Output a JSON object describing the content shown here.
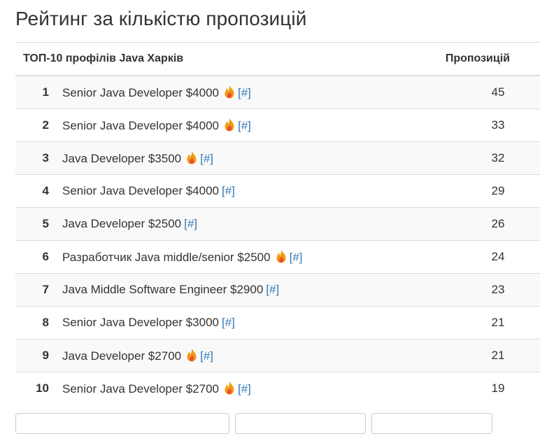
{
  "page": {
    "title": "Рейтинг за кількістю пропозицій"
  },
  "table": {
    "header_title": "ТОП-10 профілів Java Харків",
    "header_count": "Пропозицій",
    "link_label": "[#]",
    "rows": [
      {
        "rank": "1",
        "title": "Senior Java Developer $4000",
        "hot": true,
        "count": "45"
      },
      {
        "rank": "2",
        "title": "Senior Java Developer $4000",
        "hot": true,
        "count": "33"
      },
      {
        "rank": "3",
        "title": "Java Developer $3500",
        "hot": true,
        "count": "32"
      },
      {
        "rank": "4",
        "title": "Senior Java Developer $4000",
        "hot": false,
        "count": "29"
      },
      {
        "rank": "5",
        "title": "Java Developer $2500",
        "hot": false,
        "count": "26"
      },
      {
        "rank": "6",
        "title": "Разработчик Java middle/senior $2500",
        "hot": true,
        "count": "24"
      },
      {
        "rank": "7",
        "title": "Java Middle Software Engineer $2900",
        "hot": false,
        "count": "23"
      },
      {
        "rank": "8",
        "title": "Senior Java Developer $3000",
        "hot": false,
        "count": "21"
      },
      {
        "rank": "9",
        "title": "Java Developer $2700",
        "hot": true,
        "count": "21"
      },
      {
        "rank": "10",
        "title": "Senior Java Developer $2700",
        "hot": true,
        "count": "19"
      }
    ]
  },
  "icons": {
    "hot": "fire-icon"
  },
  "colors": {
    "link": "#337ab7",
    "text": "#333333",
    "stripe": "#f9f9f9",
    "border": "#dddddd",
    "fire_outer": "#f39c12",
    "fire_inner": "#e74c3c"
  }
}
